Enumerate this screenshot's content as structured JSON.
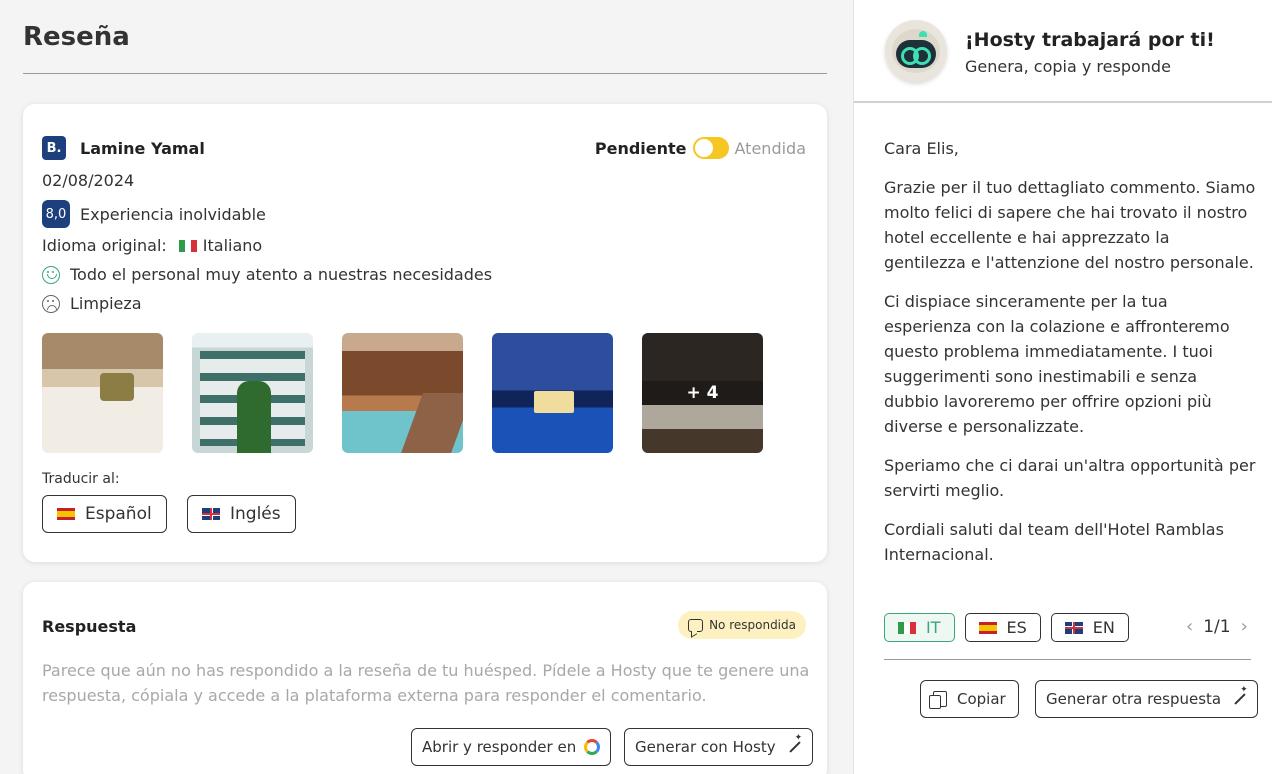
{
  "page": {
    "title": "Reseña"
  },
  "review": {
    "source_logo": "B.",
    "author": "Lamine Yamal",
    "status": {
      "pending_label": "Pendiente",
      "attended_label": "Atendida",
      "toggle_color": "#f6c623"
    },
    "date": "02/08/2024",
    "score": "8,0",
    "headline": "Experiencia inolvidable",
    "original_language_label": "Idioma original:",
    "original_language": "Italiano",
    "positive_icon": "smile-icon",
    "positive": "Todo el personal muy atento a nuestras necesidades",
    "negative_icon": "sad-face-icon",
    "negative": "Limpieza",
    "photos": [
      "photo-1",
      "photo-2",
      "photo-3",
      "photo-4",
      "photo-5"
    ],
    "more_photos": "+ 4",
    "translate_label": "Traducir al:",
    "translate_options": [
      "Español",
      "Inglés"
    ]
  },
  "reply": {
    "title": "Respuesta",
    "badge": "No respondida",
    "badge_icon": "chat-bubble-icon",
    "message": "Parece que aún no has respondido a la reseña de tu huésped. Pídele a Hosty que te genere una respuesta, cópiala y accede a la plataforma externa para responder el comentario.",
    "open_button": "Abrir y responder en",
    "open_button_icon": "google-icon",
    "generate_button": "Generar con Hosty",
    "generate_button_icon": "magic-wand-icon"
  },
  "hosty": {
    "avatar_icon": "robot-icon",
    "title": "¡Hosty trabajará por ti!",
    "subtitle": "Genera, copia y responde",
    "letter": [
      "Cara Elis,",
      "Grazie per il tuo dettagliato commento. Siamo molto felici di sapere che hai trovato il nostro hotel eccellente e hai apprezzato la gentilezza e l'attenzione del nostro personale.",
      "Ci dispiace sinceramente per la tua esperienza con la colazione e affronteremo questo problema immediatamente. I tuoi suggerimenti sono inestimabili e senza dubbio lavoreremo per offrire opzioni più diverse e personalizzate.",
      "Speriamo che ci darai un'altra opportunità per servirti meglio.",
      "Cordiali saluti dal team dell'Hotel Ramblas Internacional."
    ],
    "languages": [
      "IT",
      "ES",
      "EN"
    ],
    "active_language": "IT",
    "active_color": "#3aa67a",
    "pager": "1/1",
    "copy_button": "Copiar",
    "regenerate_button": "Generar otra respuesta"
  }
}
